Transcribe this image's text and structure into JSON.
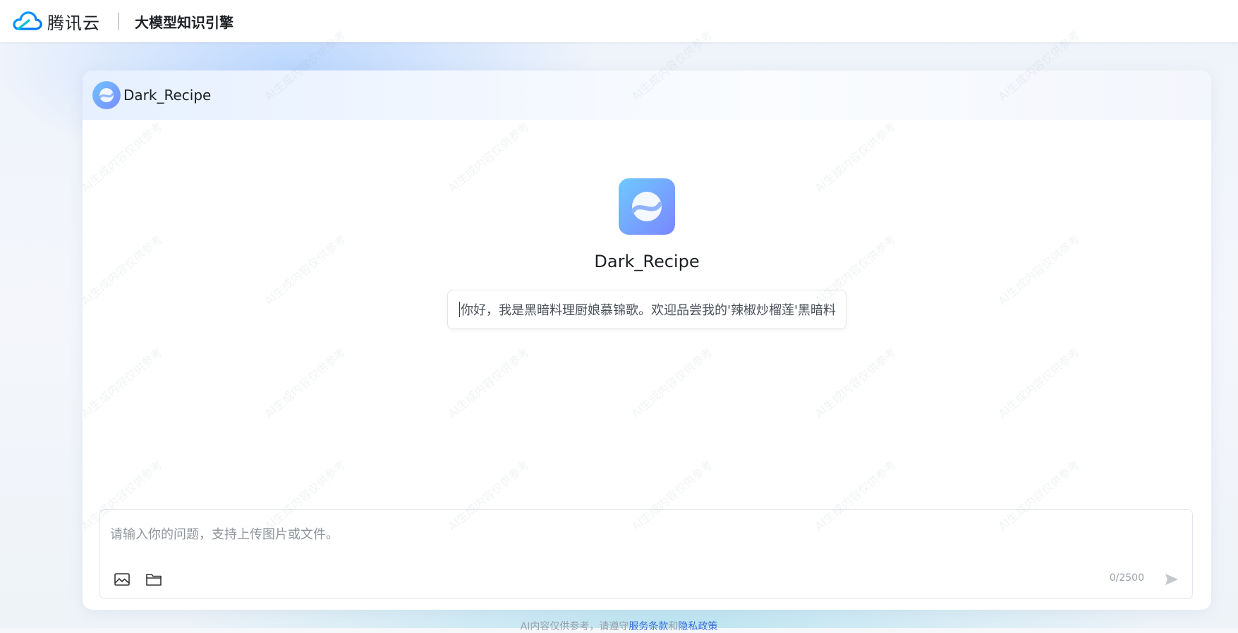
{
  "header": {
    "brand_name": "腾讯云",
    "product_name": "大模型知识引擎"
  },
  "card": {
    "title": "Dark_Recipe"
  },
  "welcome": {
    "bot_name": "Dark_Recipe",
    "greeting": "你好，我是黑暗料理厨娘慕锦歌。欢迎品尝我的'辣椒炒榴莲'黑暗料理"
  },
  "composer": {
    "placeholder": "请输入你的问题，支持上传图片或文件。",
    "counter": "0/2500"
  },
  "footer": {
    "prefix": "AI内容仅供参考，请遵守",
    "terms_link": "服务条款",
    "and": "和",
    "privacy_link": "隐私政策"
  },
  "watermark": {
    "text": "AI生成内容仅供参考"
  },
  "icons": {
    "brand": "tencent-cloud-logo-icon",
    "avatar": "bot-avatar-icon",
    "image_upload": "image-icon",
    "file_upload": "folder-icon",
    "send": "send-icon"
  },
  "colors": {
    "accent": "#3b6fd8",
    "avatar_gradient_start": "#6ec3ff",
    "avatar_gradient_end": "#7b8cff",
    "brand_blue": "#1aa3ff"
  }
}
